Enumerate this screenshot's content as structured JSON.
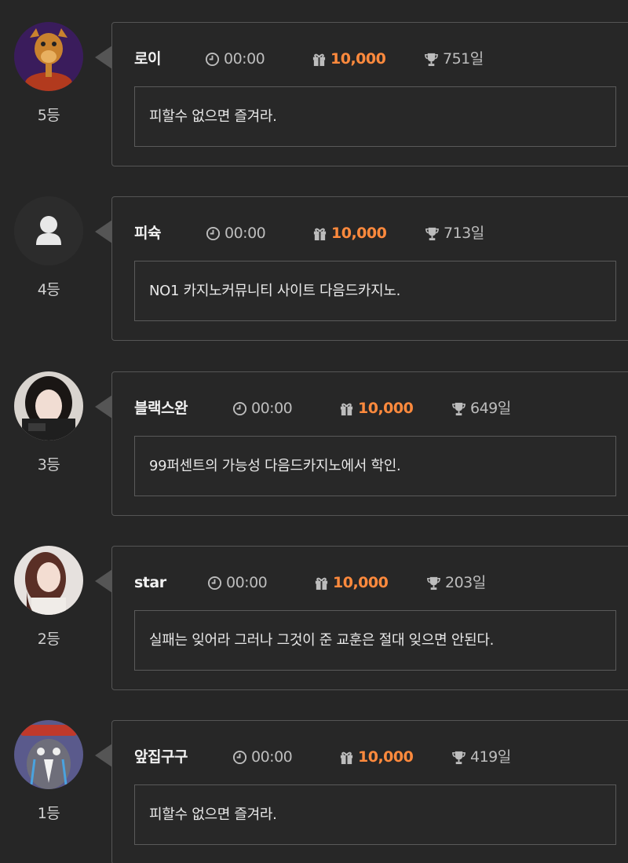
{
  "colors": {
    "background": "#262626",
    "border": "#555555",
    "accent_points": "#ff8a3d",
    "text": "#e6e6e6",
    "muted": "#bdbdbd"
  },
  "entries": [
    {
      "name": "로이",
      "time": "00:00",
      "points": "10,000",
      "days": "751일",
      "message": "피할수 없으면 즐겨라.",
      "rank": "5등",
      "avatar": "cartoon-character-avatar"
    },
    {
      "name": "피슉",
      "time": "00:00",
      "points": "10,000",
      "days": "713일",
      "message": "NO1 카지노커뮤니티 사이트 다음드카지노.",
      "rank": "4등",
      "avatar": "default-user-avatar"
    },
    {
      "name": "블랙스완",
      "time": "00:00",
      "points": "10,000",
      "days": "649일",
      "message": "99퍼센트의 가능성 다음드카지노에서 학인.",
      "rank": "3등",
      "avatar": "photo-avatar"
    },
    {
      "name": "star",
      "time": "00:00",
      "points": "10,000",
      "days": "203일",
      "message": "실패는 잊어라 그러나 그것이 준 교훈은 절대 잊으면 안된다.",
      "rank": "2등",
      "avatar": "photo-avatar"
    },
    {
      "name": "앞집구구",
      "time": "00:00",
      "points": "10,000",
      "days": "419일",
      "message": "피할수 없으면 즐겨라.",
      "rank": "1등",
      "avatar": "cartoon-bird-avatar"
    }
  ]
}
